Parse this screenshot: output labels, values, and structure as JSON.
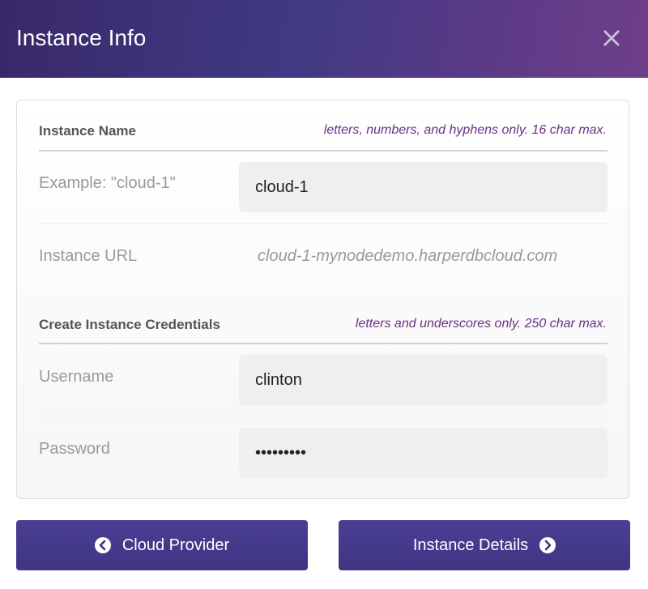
{
  "header": {
    "title": "Instance Info",
    "close_icon": "close-icon"
  },
  "instance_name": {
    "label": "Instance Name",
    "hint": "letters, numbers, and hyphens only. 16 char max.",
    "field_label": "Example: \"cloud-1\"",
    "value": "cloud-1"
  },
  "instance_url": {
    "label": "Instance URL",
    "value": "cloud-1-mynodedemo.harperdbcloud.com"
  },
  "credentials": {
    "label": "Create Instance Credentials",
    "hint": "letters and underscores only. 250 char max.",
    "username_label": "Username",
    "username_value": "clinton",
    "password_label": "Password",
    "password_value": "•••••••••"
  },
  "footer": {
    "back_label": "Cloud Provider",
    "back_icon": "chevron-left-circle-icon",
    "next_label": "Instance Details",
    "next_icon": "chevron-right-circle-icon"
  },
  "colors": {
    "accent": "#3f3582",
    "hint": "#6b2f85"
  }
}
